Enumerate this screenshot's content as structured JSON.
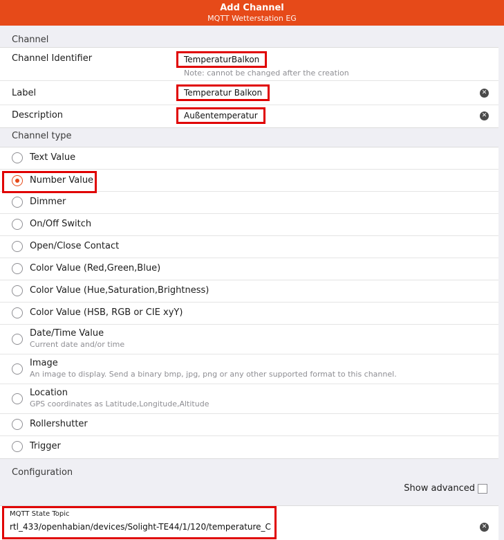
{
  "header": {
    "title": "Add Channel",
    "subtitle": "MQTT Wetterstation EG"
  },
  "channel": {
    "section_title": "Channel",
    "identifier_label": "Channel Identifier",
    "identifier_value": "TemperaturBalkon",
    "identifier_note": "Note: cannot be changed after the creation",
    "label_label": "Label",
    "label_value": "Temperatur Balkon",
    "description_label": "Description",
    "description_value": "Außentemperatur"
  },
  "channel_type": {
    "section_title": "Channel type",
    "selected": "Number Value",
    "options": [
      {
        "label": "Text Value",
        "desc": ""
      },
      {
        "label": "Number Value",
        "desc": ""
      },
      {
        "label": "Dimmer",
        "desc": ""
      },
      {
        "label": "On/Off Switch",
        "desc": ""
      },
      {
        "label": "Open/Close Contact",
        "desc": ""
      },
      {
        "label": "Color Value (Red,Green,Blue)",
        "desc": ""
      },
      {
        "label": "Color Value (Hue,Saturation,Brightness)",
        "desc": ""
      },
      {
        "label": "Color Value (HSB, RGB or CIE xyY)",
        "desc": ""
      },
      {
        "label": "Date/Time Value",
        "desc": "Current date and/or time"
      },
      {
        "label": "Image",
        "desc": "An image to display. Send a binary bmp, jpg, png or any other supported format to this channel."
      },
      {
        "label": "Location",
        "desc": "GPS coordinates as Latitude,Longitude,Altitude"
      },
      {
        "label": "Rollershutter",
        "desc": ""
      },
      {
        "label": "Trigger",
        "desc": ""
      }
    ]
  },
  "configuration": {
    "section_title": "Configuration",
    "show_advanced_label": "Show advanced",
    "show_advanced_checked": false,
    "mqtt_state_topic_label": "MQTT State Topic",
    "mqtt_state_topic_value": "rtl_433/openhabian/devices/Solight-TE44/1/120/temperature_C"
  },
  "colors": {
    "accent": "#e64a19",
    "highlight": "#e00000",
    "background": "#efeff4"
  }
}
